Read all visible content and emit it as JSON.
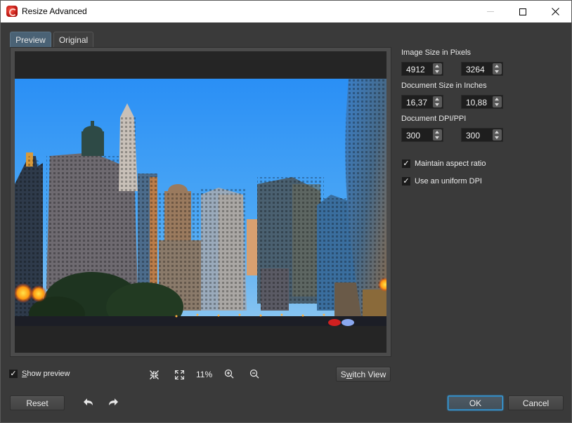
{
  "window": {
    "title": "Resize Advanced",
    "controls": {
      "minimize": "minimize",
      "maximize": "maximize",
      "close": "close"
    }
  },
  "tabs": [
    {
      "label": "Preview",
      "active": true
    },
    {
      "label": "Original",
      "active": false
    }
  ],
  "settings": {
    "image_size": {
      "label": "Image Size in Pixels",
      "width": "4912",
      "height": "3264"
    },
    "document_size": {
      "label": "Document Size in Inches",
      "width": "16,37",
      "height": "10,88"
    },
    "dpi": {
      "label": "Document DPI/PPI",
      "horizontal": "300",
      "vertical": "300"
    },
    "maintain_aspect_ratio": {
      "label": "Maintain aspect ratio",
      "checked": true
    },
    "uniform_dpi": {
      "label": "Use an uniform DPI",
      "checked": true
    }
  },
  "preview_toolbar": {
    "show_preview": {
      "label": "Show preview",
      "mnemonic": "S",
      "rest": "how preview",
      "checked": true
    },
    "fit_icon": "compress-icon",
    "actual_size_icon": "expand-icon",
    "zoom_level": "11%",
    "zoom_in_icon": "zoom-in-icon",
    "zoom_out_icon": "zoom-out-icon",
    "switch_view": {
      "label": "Switch View",
      "pre": "S",
      "mnemonic": "w",
      "rest": "itch View"
    }
  },
  "footer": {
    "reset": "Reset",
    "undo_icon": "undo-icon",
    "redo_icon": "redo-icon",
    "ok": "OK",
    "cancel": "Cancel"
  },
  "preview_image": {
    "description": "City skyline photo of riverfront skyscrapers at dusk"
  }
}
